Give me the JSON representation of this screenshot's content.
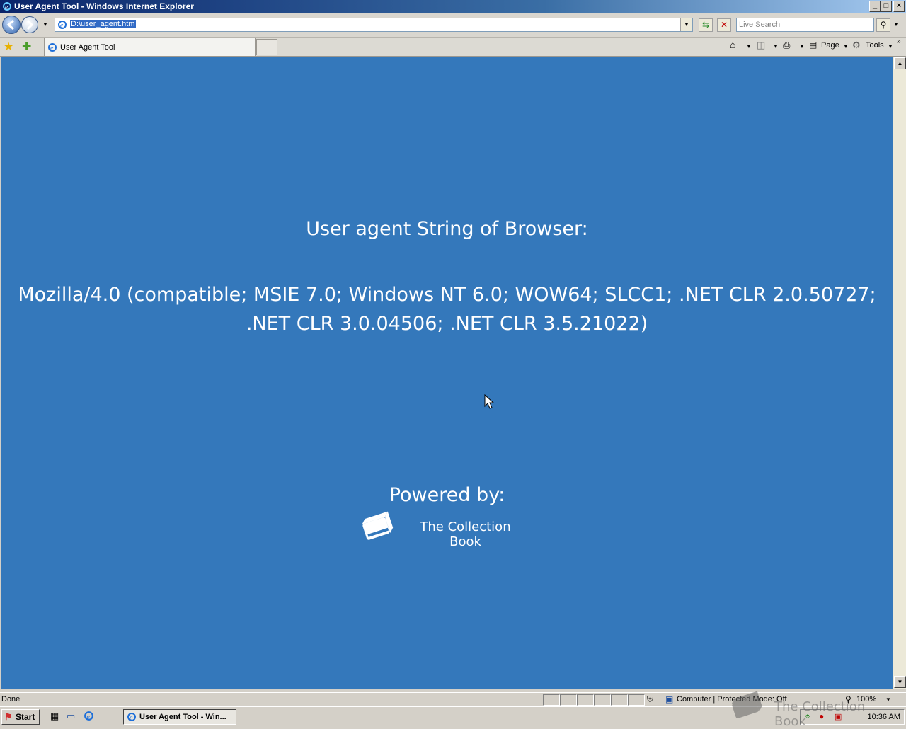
{
  "window": {
    "title": "User Agent Tool - Windows Internet Explorer"
  },
  "toolbar": {
    "address": "D:\\user_agent.htm",
    "search_placeholder": "Live Search"
  },
  "tabs": [
    {
      "label": "User Agent Tool"
    }
  ],
  "command_bar": {
    "page_label": "Page",
    "tools_label": "Tools"
  },
  "page": {
    "heading": "User agent String of Browser:",
    "user_agent": "Mozilla/4.0 (compatible; MSIE 7.0; Windows NT 6.0; WOW64; SLCC1; .NET CLR 2.0.50727; .NET CLR 3.0.04506; .NET CLR 3.5.21022)",
    "powered_by": "Powered by:",
    "brand_name": "The Collection Book",
    "background_color": "#3478bb"
  },
  "status": {
    "text": "Done",
    "zone": "Computer | Protected Mode: Off",
    "zoom": "100%"
  },
  "taskbar": {
    "start_label": "Start",
    "task_label": "User Agent Tool - Win...",
    "clock": "10:36 AM"
  },
  "watermark": {
    "text": "The Collection Book"
  },
  "icons": [
    "ie-icon",
    "back-icon",
    "forward-icon",
    "refresh-icon",
    "stop-icon",
    "search-icon",
    "favorites-star-icon",
    "add-favorites-icon",
    "home-icon",
    "feeds-icon",
    "print-icon",
    "page-icon",
    "tools-gear-icon",
    "book-icon",
    "zoom-icon",
    "start-flag-icon"
  ]
}
